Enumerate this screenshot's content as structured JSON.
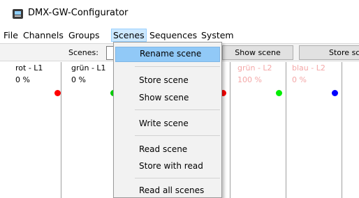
{
  "window": {
    "title": "DMX-GW-Configurator"
  },
  "menubar": {
    "items": [
      {
        "label": "File",
        "active": false
      },
      {
        "label": "Channels",
        "active": false
      },
      {
        "label": "Groups",
        "active": false
      },
      {
        "label": "Scenes",
        "active": true
      },
      {
        "label": "Sequences",
        "active": false
      },
      {
        "label": "System",
        "active": false
      }
    ]
  },
  "toolbar": {
    "scenes_label": "Scenes:",
    "show_scene_label": "Show scene",
    "store_scene_label": "Store sc"
  },
  "channels": [
    {
      "name": "rot - L1",
      "value": "0 %",
      "led_color": "#ff0000",
      "dim": false
    },
    {
      "name": "grün - L1",
      "value": "0 %",
      "led_color": "#00cc00",
      "dim": false
    },
    {
      "name": "",
      "value": "",
      "led_color": "#ff0000",
      "dim": false
    },
    {
      "name": "grün - L2",
      "value": "100 %",
      "led_color": "#00ee00",
      "dim": true
    },
    {
      "name": "blau - L2",
      "value": "0 %",
      "led_color": "#0000ff",
      "dim": true
    },
    {
      "name": "",
      "value": "",
      "led_color": "",
      "dim": false
    }
  ],
  "scenes_menu": {
    "items": [
      {
        "label": "Rename scene",
        "highlighted": true
      },
      {
        "label": "Store scene",
        "highlighted": false
      },
      {
        "label": "Show scene",
        "highlighted": false
      },
      {
        "label": "Write scene",
        "highlighted": false
      },
      {
        "label": "Read scene",
        "highlighted": false
      },
      {
        "label": "Store with read",
        "highlighted": false
      },
      {
        "label": "Read all scenes",
        "highlighted": false
      }
    ]
  },
  "colors": {
    "menu_highlight": "#91c9f7",
    "menubar_active": "#cce8ff",
    "dim_text": "#f4a7a7"
  }
}
